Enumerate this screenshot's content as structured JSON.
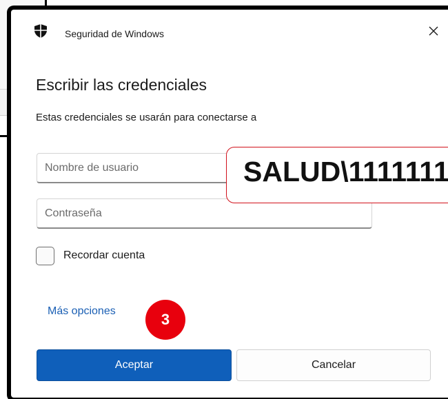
{
  "dialog": {
    "app_title": "Seguridad de Windows",
    "close_glyph": "✕",
    "heading": "Escribir las credenciales",
    "subtitle": "Estas credenciales se usarán para conectarse a",
    "username": {
      "value": "",
      "placeholder": "Nombre de usuario"
    },
    "password": {
      "value": "",
      "placeholder": "Contraseña"
    },
    "remember": {
      "label": "Recordar cuenta",
      "checked": false
    },
    "more_options": "Más opciones",
    "ok_button": "Aceptar",
    "cancel_button": "Cancelar"
  },
  "annotations": {
    "callout_text": "SALUD\\1111111",
    "step_badge": "3"
  },
  "icons": {
    "app": "shield-icon",
    "close": "close-icon"
  },
  "colors": {
    "accent": "#0f5fba",
    "link": "#1a5fb4",
    "badge": "#e8000d",
    "callout_border": "#d1101a"
  }
}
